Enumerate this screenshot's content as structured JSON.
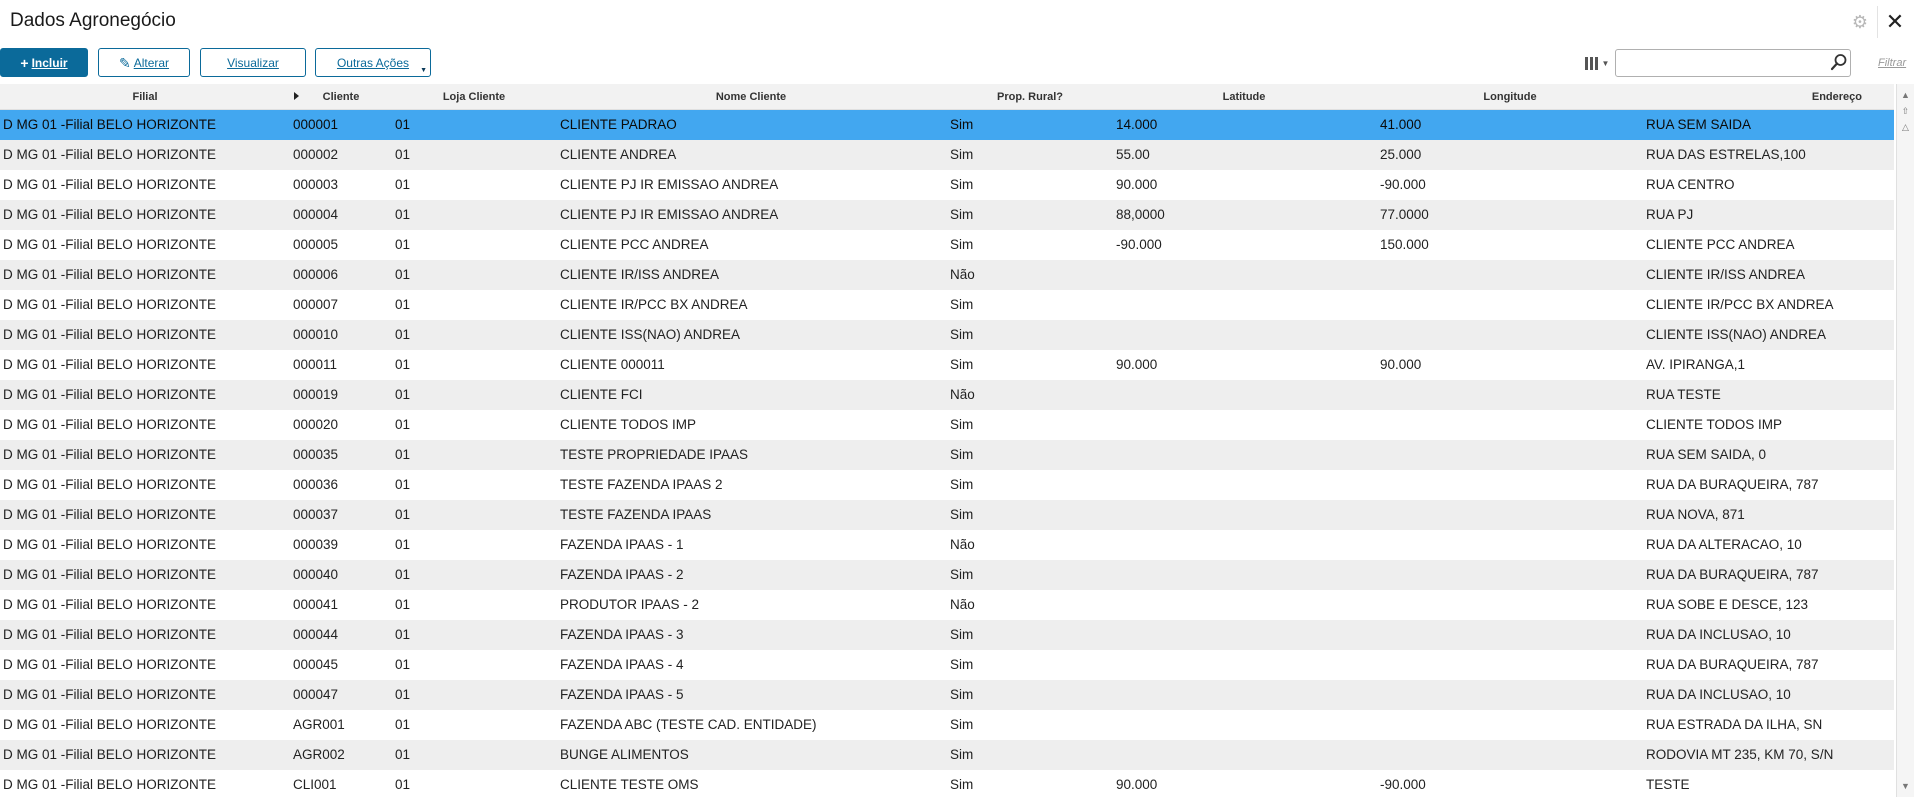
{
  "window": {
    "title": "Dados Agronegócio"
  },
  "toolbar": {
    "incluir": "Incluir",
    "alterar": "Alterar",
    "visualizar": "Visualizar",
    "outras_acoes": "Outras Ações",
    "search_value": "",
    "filtrar": "Filtrar"
  },
  "columns": {
    "filial": "Filial",
    "cliente": "Cliente",
    "loja": "Loja Cliente",
    "nome": "Nome Cliente",
    "prop": "Prop. Rural?",
    "lat": "Latitude",
    "lon": "Longitude",
    "end": "Endereço"
  },
  "rows": [
    {
      "filial": "D MG 01 -Filial BELO HORIZONTE",
      "cliente": "000001",
      "loja": "01",
      "nome": "CLIENTE PADRAO",
      "prop": "Sim",
      "lat": "14.000",
      "lon": "41.000",
      "end": "RUA SEM SAIDA"
    },
    {
      "filial": "D MG 01 -Filial BELO HORIZONTE",
      "cliente": "000002",
      "loja": "01",
      "nome": "CLIENTE ANDREA",
      "prop": "Sim",
      "lat": "55.00",
      "lon": "25.000",
      "end": "RUA DAS ESTRELAS,100"
    },
    {
      "filial": "D MG 01 -Filial BELO HORIZONTE",
      "cliente": "000003",
      "loja": "01",
      "nome": "CLIENTE PJ IR EMISSAO ANDREA",
      "prop": "Sim",
      "lat": "90.000",
      "lon": "-90.000",
      "end": "RUA CENTRO"
    },
    {
      "filial": "D MG 01 -Filial BELO HORIZONTE",
      "cliente": "000004",
      "loja": "01",
      "nome": "CLIENTE PJ IR EMISSAO ANDREA",
      "prop": "Sim",
      "lat": "88,0000",
      "lon": "77.0000",
      "end": "RUA PJ"
    },
    {
      "filial": "D MG 01 -Filial BELO HORIZONTE",
      "cliente": "000005",
      "loja": "01",
      "nome": "CLIENTE PCC ANDREA",
      "prop": "Sim",
      "lat": "-90.000",
      "lon": "150.000",
      "end": "CLIENTE PCC ANDREA"
    },
    {
      "filial": "D MG 01 -Filial BELO HORIZONTE",
      "cliente": "000006",
      "loja": "01",
      "nome": "CLIENTE IR/ISS ANDREA",
      "prop": "Não",
      "lat": "",
      "lon": "",
      "end": "CLIENTE IR/ISS ANDREA"
    },
    {
      "filial": "D MG 01 -Filial BELO HORIZONTE",
      "cliente": "000007",
      "loja": "01",
      "nome": "CLIENTE IR/PCC BX ANDREA",
      "prop": "Sim",
      "lat": "",
      "lon": "",
      "end": "CLIENTE IR/PCC BX ANDREA"
    },
    {
      "filial": "D MG 01 -Filial BELO HORIZONTE",
      "cliente": "000010",
      "loja": "01",
      "nome": "CLIENTE ISS(NAO) ANDREA",
      "prop": "Sim",
      "lat": "",
      "lon": "",
      "end": "CLIENTE ISS(NAO) ANDREA"
    },
    {
      "filial": "D MG 01 -Filial BELO HORIZONTE",
      "cliente": "000011",
      "loja": "01",
      "nome": "CLIENTE 000011",
      "prop": "Sim",
      "lat": "90.000",
      "lon": "90.000",
      "end": "AV. IPIRANGA,1"
    },
    {
      "filial": "D MG 01 -Filial BELO HORIZONTE",
      "cliente": "000019",
      "loja": "01",
      "nome": "CLIENTE FCI",
      "prop": "Não",
      "lat": "",
      "lon": "",
      "end": "RUA TESTE"
    },
    {
      "filial": "D MG 01 -Filial BELO HORIZONTE",
      "cliente": "000020",
      "loja": "01",
      "nome": "CLIENTE TODOS IMP",
      "prop": "Sim",
      "lat": "",
      "lon": "",
      "end": "CLIENTE TODOS IMP"
    },
    {
      "filial": "D MG 01 -Filial BELO HORIZONTE",
      "cliente": "000035",
      "loja": "01",
      "nome": "TESTE PROPRIEDADE IPAAS",
      "prop": "Sim",
      "lat": "",
      "lon": "",
      "end": "RUA SEM SAIDA, 0"
    },
    {
      "filial": "D MG 01 -Filial BELO HORIZONTE",
      "cliente": "000036",
      "loja": "01",
      "nome": "TESTE FAZENDA IPAAS 2",
      "prop": "Sim",
      "lat": "",
      "lon": "",
      "end": "RUA DA BURAQUEIRA, 787"
    },
    {
      "filial": "D MG 01 -Filial BELO HORIZONTE",
      "cliente": "000037",
      "loja": "01",
      "nome": "TESTE FAZENDA IPAAS",
      "prop": "Sim",
      "lat": "",
      "lon": "",
      "end": "RUA NOVA, 871"
    },
    {
      "filial": "D MG 01 -Filial BELO HORIZONTE",
      "cliente": "000039",
      "loja": "01",
      "nome": "FAZENDA IPAAS - 1",
      "prop": "Não",
      "lat": "",
      "lon": "",
      "end": "RUA DA ALTERACAO, 10"
    },
    {
      "filial": "D MG 01 -Filial BELO HORIZONTE",
      "cliente": "000040",
      "loja": "01",
      "nome": "FAZENDA IPAAS - 2",
      "prop": "Sim",
      "lat": "",
      "lon": "",
      "end": "RUA DA BURAQUEIRA, 787"
    },
    {
      "filial": "D MG 01 -Filial BELO HORIZONTE",
      "cliente": "000041",
      "loja": "01",
      "nome": "PRODUTOR IPAAS - 2",
      "prop": "Não",
      "lat": "",
      "lon": "",
      "end": "RUA SOBE E DESCE, 123"
    },
    {
      "filial": "D MG 01 -Filial BELO HORIZONTE",
      "cliente": "000044",
      "loja": "01",
      "nome": "FAZENDA IPAAS - 3",
      "prop": "Sim",
      "lat": "",
      "lon": "",
      "end": "RUA DA INCLUSAO, 10"
    },
    {
      "filial": "D MG 01 -Filial BELO HORIZONTE",
      "cliente": "000045",
      "loja": "01",
      "nome": "FAZENDA IPAAS - 4",
      "prop": "Sim",
      "lat": "",
      "lon": "",
      "end": "RUA DA BURAQUEIRA, 787"
    },
    {
      "filial": "D MG 01 -Filial BELO HORIZONTE",
      "cliente": "000047",
      "loja": "01",
      "nome": "FAZENDA IPAAS - 5",
      "prop": "Sim",
      "lat": "",
      "lon": "",
      "end": "RUA DA INCLUSAO, 10"
    },
    {
      "filial": "D MG 01 -Filial BELO HORIZONTE",
      "cliente": "AGR001",
      "loja": "01",
      "nome": "FAZENDA ABC (TESTE CAD. ENTIDADE)",
      "prop": "Sim",
      "lat": "",
      "lon": "",
      "end": "RUA ESTRADA DA ILHA, SN"
    },
    {
      "filial": "D MG 01 -Filial BELO HORIZONTE",
      "cliente": "AGR002",
      "loja": "01",
      "nome": "BUNGE ALIMENTOS",
      "prop": "Sim",
      "lat": "",
      "lon": "",
      "end": "RODOVIA MT 235, KM 70, S/N"
    },
    {
      "filial": "D MG 01 -Filial BELO HORIZONTE",
      "cliente": "CLI001",
      "loja": "01",
      "nome": "CLIENTE TESTE OMS",
      "prop": "Sim",
      "lat": "90.000",
      "lon": "-90.000",
      "end": "TESTE"
    }
  ],
  "selected_row": 0,
  "colors": {
    "accent": "#0b6a9a",
    "selected_row": "#42a7f0",
    "zebra": "#eeeeee"
  },
  "icons": {
    "settings": "gear-icon",
    "close": "close-icon",
    "search": "search-icon",
    "columns": "columns-icon"
  }
}
